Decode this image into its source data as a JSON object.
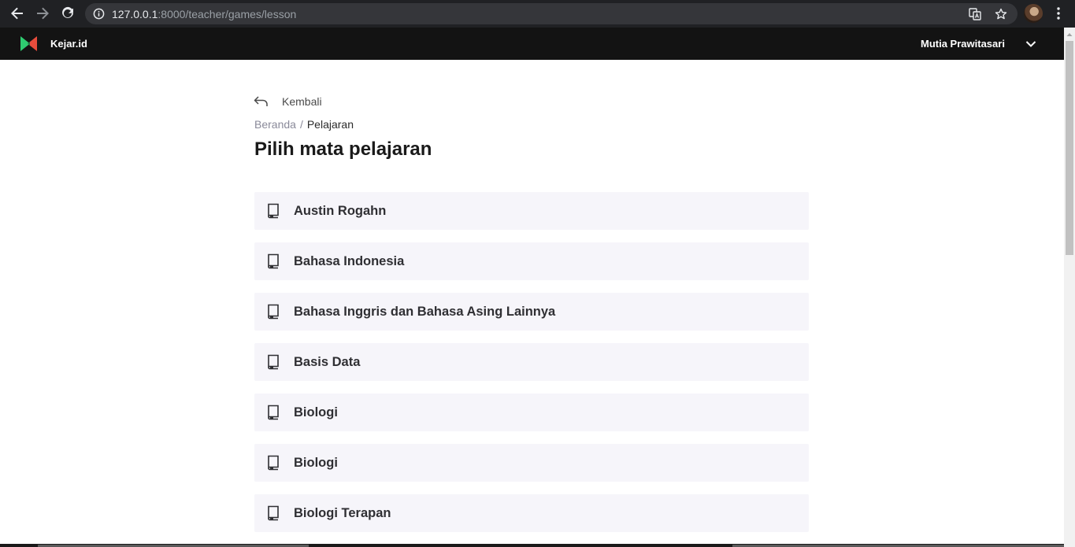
{
  "browser": {
    "url_host": "127.0.0.1",
    "url_rest": ":8000/teacher/games/lesson"
  },
  "header": {
    "brand": "Kejar.id",
    "user_name": "Mutia Prawitasari"
  },
  "main": {
    "back_label": "Kembali",
    "breadcrumb": {
      "home": "Beranda",
      "separator": "/",
      "current": "Pelajaran"
    },
    "title": "Pilih mata pelajaran",
    "lessons": [
      "Austin Rogahn",
      "Bahasa Indonesia",
      "Bahasa Inggris dan Bahasa Asing Lainnya",
      "Basis Data",
      "Biologi",
      "Biologi",
      "Biologi Terapan"
    ]
  },
  "colors": {
    "chrome_bg": "#202124",
    "omnibox_bg": "#35363a",
    "appbar_bg": "#131313",
    "list_item_bg": "#f6f5fa",
    "logo_green": "#2ecc71",
    "logo_red": "#e74c3c"
  },
  "icons": {
    "back": "arrow-back-icon",
    "forward": "arrow-forward-icon",
    "reload": "reload-icon",
    "info": "info-icon",
    "translate": "translate-icon",
    "bookmark": "star-icon",
    "menu": "kebab-menu-icon",
    "user_menu": "chevron-down-icon",
    "return": "return-arrow-icon",
    "lesson": "book-icon"
  }
}
